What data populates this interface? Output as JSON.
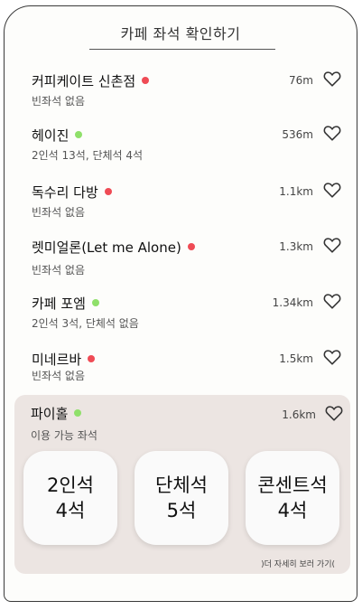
{
  "header": {
    "title": "카페 좌석 확인하기"
  },
  "cafes": [
    {
      "name": "커피케이트 신촌점",
      "status": "red",
      "sub": "빈좌석 없음",
      "distance": "76m"
    },
    {
      "name": "헤이진",
      "status": "green",
      "sub": "2인석 13석, 단체석 4석",
      "distance": "536m"
    },
    {
      "name": "독수리 다방",
      "status": "red",
      "sub": "빈좌석 없음",
      "distance": "1.1km"
    },
    {
      "name": "렛미얼론(Let me Alone)",
      "status": "red",
      "sub": "빈좌석 없음",
      "distance": "1.3km"
    },
    {
      "name": "카페 포엠",
      "status": "green",
      "sub": "2인석 3석, 단체석 없음",
      "distance": "1.34km"
    },
    {
      "name": "미네르바",
      "status": "red",
      "sub": "빈좌석 없음",
      "distance": "1.5km"
    }
  ],
  "featured": {
    "name": "파이홀",
    "status": "green",
    "sub": "이용 가능 좌석",
    "distance": "1.6km",
    "seats": [
      {
        "type": "2인석",
        "count": "4석"
      },
      {
        "type": "단체석",
        "count": "5석"
      },
      {
        "type": "콘센트석",
        "count": "4석"
      }
    ],
    "more_link": ")더 자세히 보러 가기("
  },
  "colors": {
    "unavailable": "#ef4b55",
    "available": "#8fe06a",
    "card_bg": "#ece5e2"
  }
}
